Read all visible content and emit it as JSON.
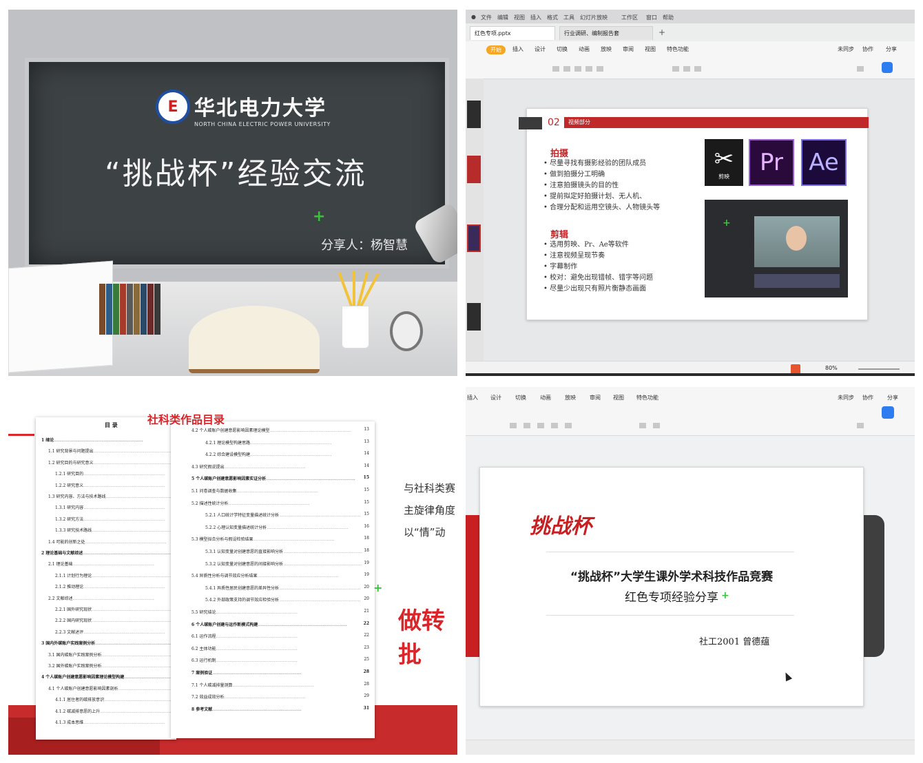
{
  "q1": {
    "university_cn": "华北电力大学",
    "university_en": "NORTH CHINA ELECTRIC POWER UNIVERSITY",
    "title": "“挑战杯”经验交流",
    "sharer": "分享人：杨智慧",
    "logo_glyph": "E"
  },
  "q2": {
    "menubar": [
      "文件",
      "编辑",
      "视图",
      "插入",
      "格式",
      "工具",
      "幻灯片放映",
      "工作区",
      "窗口",
      "帮助"
    ],
    "tabs": [
      "红色专项.pptx",
      "行业调研、编制报告套"
    ],
    "ribbon_tabs": [
      "开始",
      "插入",
      "设计",
      "切换",
      "动画",
      "放映",
      "审阅",
      "视图",
      "特色功能"
    ],
    "ribbon_right": [
      "未同步",
      "协作",
      "分享"
    ],
    "slide": {
      "number": "02",
      "bar_label": "视频部分",
      "section1_title": "拍摄",
      "section1_items": [
        "尽量寻找有摄影经验的团队成员",
        "做到拍摄分工明确",
        "注意拍摄镜头的目的性",
        "提前拟定好拍摄计划、无人机、",
        "合理分配和运用空镜头、人物镜头等"
      ],
      "section2_title": "剪辑",
      "section2_items": [
        "选用剪映、Pr、Ae等软件",
        "注意视频呈现节奏",
        "字幕制作",
        "校对：避免出现错帧、错字等问题",
        "尽量少出现只有照片衡静态画面"
      ],
      "apps": [
        {
          "label": "剪映",
          "glyph": "✂",
          "color": "#1a1a1a"
        },
        {
          "label": "",
          "glyph": "Pr",
          "color": "#2a0a3a"
        },
        {
          "label": "",
          "glyph": "Ae",
          "color": "#1c0a3a"
        }
      ]
    },
    "status": {
      "zoom": "80%"
    }
  },
  "q3": {
    "title": "社科类作品目录",
    "toc_header": "目 录",
    "toc_left": [
      {
        "t": "1 绪论",
        "p": "",
        "b": true,
        "i": 0
      },
      {
        "t": "1.1 研究背景与问题提出",
        "p": "",
        "b": false,
        "i": 1
      },
      {
        "t": "1.2 研究目的与研究意义",
        "p": "",
        "b": false,
        "i": 1
      },
      {
        "t": "1.2.1 研究目的",
        "p": "",
        "b": false,
        "i": 2
      },
      {
        "t": "1.2.2 研究意义",
        "p": "",
        "b": false,
        "i": 2
      },
      {
        "t": "1.3 研究内容、方法与技术路线",
        "p": "",
        "b": false,
        "i": 1
      },
      {
        "t": "1.3.1 研究内容",
        "p": "",
        "b": false,
        "i": 2
      },
      {
        "t": "1.3.2 研究方法",
        "p": "",
        "b": false,
        "i": 2
      },
      {
        "t": "1.3.3 研究技术路线",
        "p": "",
        "b": false,
        "i": 2
      },
      {
        "t": "1.4 可能的创新之处",
        "p": "",
        "b": false,
        "i": 1
      },
      {
        "t": "2 理论基础与文献综述",
        "p": "",
        "b": true,
        "i": 0
      },
      {
        "t": "2.1 理论基础",
        "p": "",
        "b": false,
        "i": 1
      },
      {
        "t": "2.1.1 计划行为理论",
        "p": "",
        "b": false,
        "i": 2
      },
      {
        "t": "2.1.2 推动理论",
        "p": "",
        "b": false,
        "i": 2
      },
      {
        "t": "2.2 文献综述",
        "p": "",
        "b": false,
        "i": 1
      },
      {
        "t": "2.2.1 国外研究现状",
        "p": "",
        "b": false,
        "i": 2
      },
      {
        "t": "2.2.2 国内研究现状",
        "p": "",
        "b": false,
        "i": 2
      },
      {
        "t": "2.2.3 文献述评",
        "p": "",
        "b": false,
        "i": 2
      },
      {
        "t": "3 国内外碳账户实践案例分析",
        "p": "",
        "b": true,
        "i": 0
      },
      {
        "t": "3.1 国内碳账户实践案例分析",
        "p": "",
        "b": false,
        "i": 1
      },
      {
        "t": "3.2 国外碳账户实践案例分析",
        "p": "",
        "b": false,
        "i": 1
      },
      {
        "t": "4 个人碳账户创建意愿影响因素理论模型构建",
        "p": "",
        "b": true,
        "i": 0
      },
      {
        "t": "4.1 个人碳账户创建意愿影响因素剖析",
        "p": "",
        "b": false,
        "i": 1
      },
      {
        "t": "4.1.1 居住者的碳排放意识",
        "p": "",
        "b": false,
        "i": 2
      },
      {
        "t": "4.1.2 碳减排意愿的上升",
        "p": "",
        "b": false,
        "i": 2
      },
      {
        "t": "4.1.3 成本思维",
        "p": "",
        "b": false,
        "i": 2
      }
    ],
    "toc_right": [
      {
        "t": "4.2 个人碳账户创建意愿影响因素理论模型",
        "p": "13",
        "b": false,
        "i": 0
      },
      {
        "t": "4.2.1 理论模型构建思路",
        "p": "13",
        "b": false,
        "i": 1
      },
      {
        "t": "4.2.2 综合建设模型构建",
        "p": "14",
        "b": false,
        "i": 1
      },
      {
        "t": "4.3 研究假说提出",
        "p": "14",
        "b": false,
        "i": 0
      },
      {
        "t": "5 个人碳账户创建意愿影响因素实证分析",
        "p": "15",
        "b": true,
        "i": 0
      },
      {
        "t": "5.1 问卷调查与数据收集",
        "p": "15",
        "b": false,
        "i": 0
      },
      {
        "t": "5.2 描述性统计分析",
        "p": "15",
        "b": false,
        "i": 0
      },
      {
        "t": "5.2.1 人口统计学特征变量描述统计分析",
        "p": "15",
        "b": false,
        "i": 1
      },
      {
        "t": "5.2.2 心理认知变量描述统计分析",
        "p": "16",
        "b": false,
        "i": 1
      },
      {
        "t": "5.3 模型拟合分析与假设检验结果",
        "p": "18",
        "b": false,
        "i": 0
      },
      {
        "t": "5.3.1 认知变量对创建意愿的直接影响分析",
        "p": "18",
        "b": false,
        "i": 1
      },
      {
        "t": "5.3.2 认知变量对创建意愿的间接影响分析",
        "p": "19",
        "b": false,
        "i": 1
      },
      {
        "t": "5.4 异质性分析与调节效应分析结果",
        "p": "19",
        "b": false,
        "i": 0
      },
      {
        "t": "5.4.1 异质性居民创建意愿的差异性分析",
        "p": "20",
        "b": false,
        "i": 1
      },
      {
        "t": "5.4.2 外部政策支持的调节效应检验分析",
        "p": "20",
        "b": false,
        "i": 1
      },
      {
        "t": "5.5 研究结论",
        "p": "21",
        "b": false,
        "i": 0
      },
      {
        "t": "6 个人碳账户创建与运作新模式构建",
        "p": "22",
        "b": true,
        "i": 0
      },
      {
        "t": "6.1 运作流程",
        "p": "22",
        "b": false,
        "i": 0
      },
      {
        "t": "6.2 主体功能",
        "p": "23",
        "b": false,
        "i": 0
      },
      {
        "t": "6.3 运行机制",
        "p": "25",
        "b": false,
        "i": 0
      },
      {
        "t": "7 案例验证",
        "p": "28",
        "b": true,
        "i": 0
      },
      {
        "t": "7.1 个人碳减排量测算",
        "p": "28",
        "b": false,
        "i": 0
      },
      {
        "t": "7.2 效益成效分析",
        "p": "29",
        "b": false,
        "i": 0
      },
      {
        "t": "8 参考文献",
        "p": "31",
        "b": true,
        "i": 0
      }
    ],
    "side_lines": [
      "与社科类赛",
      "主旋律角度",
      "以“情”动"
    ],
    "big_text": "做转批"
  },
  "q4": {
    "ribbon_tabs": [
      "插入",
      "设计",
      "切换",
      "动画",
      "放映",
      "审阅",
      "视图",
      "特色功能"
    ],
    "ribbon_right": [
      "未同步",
      "协作",
      "分享"
    ],
    "slide": {
      "brand": "挑战杯",
      "line1": "“挑战杯”大学生课外学术科技作品竞赛",
      "line2": "红色专项经验分享",
      "author": "社工2001 曾德蕴"
    }
  }
}
